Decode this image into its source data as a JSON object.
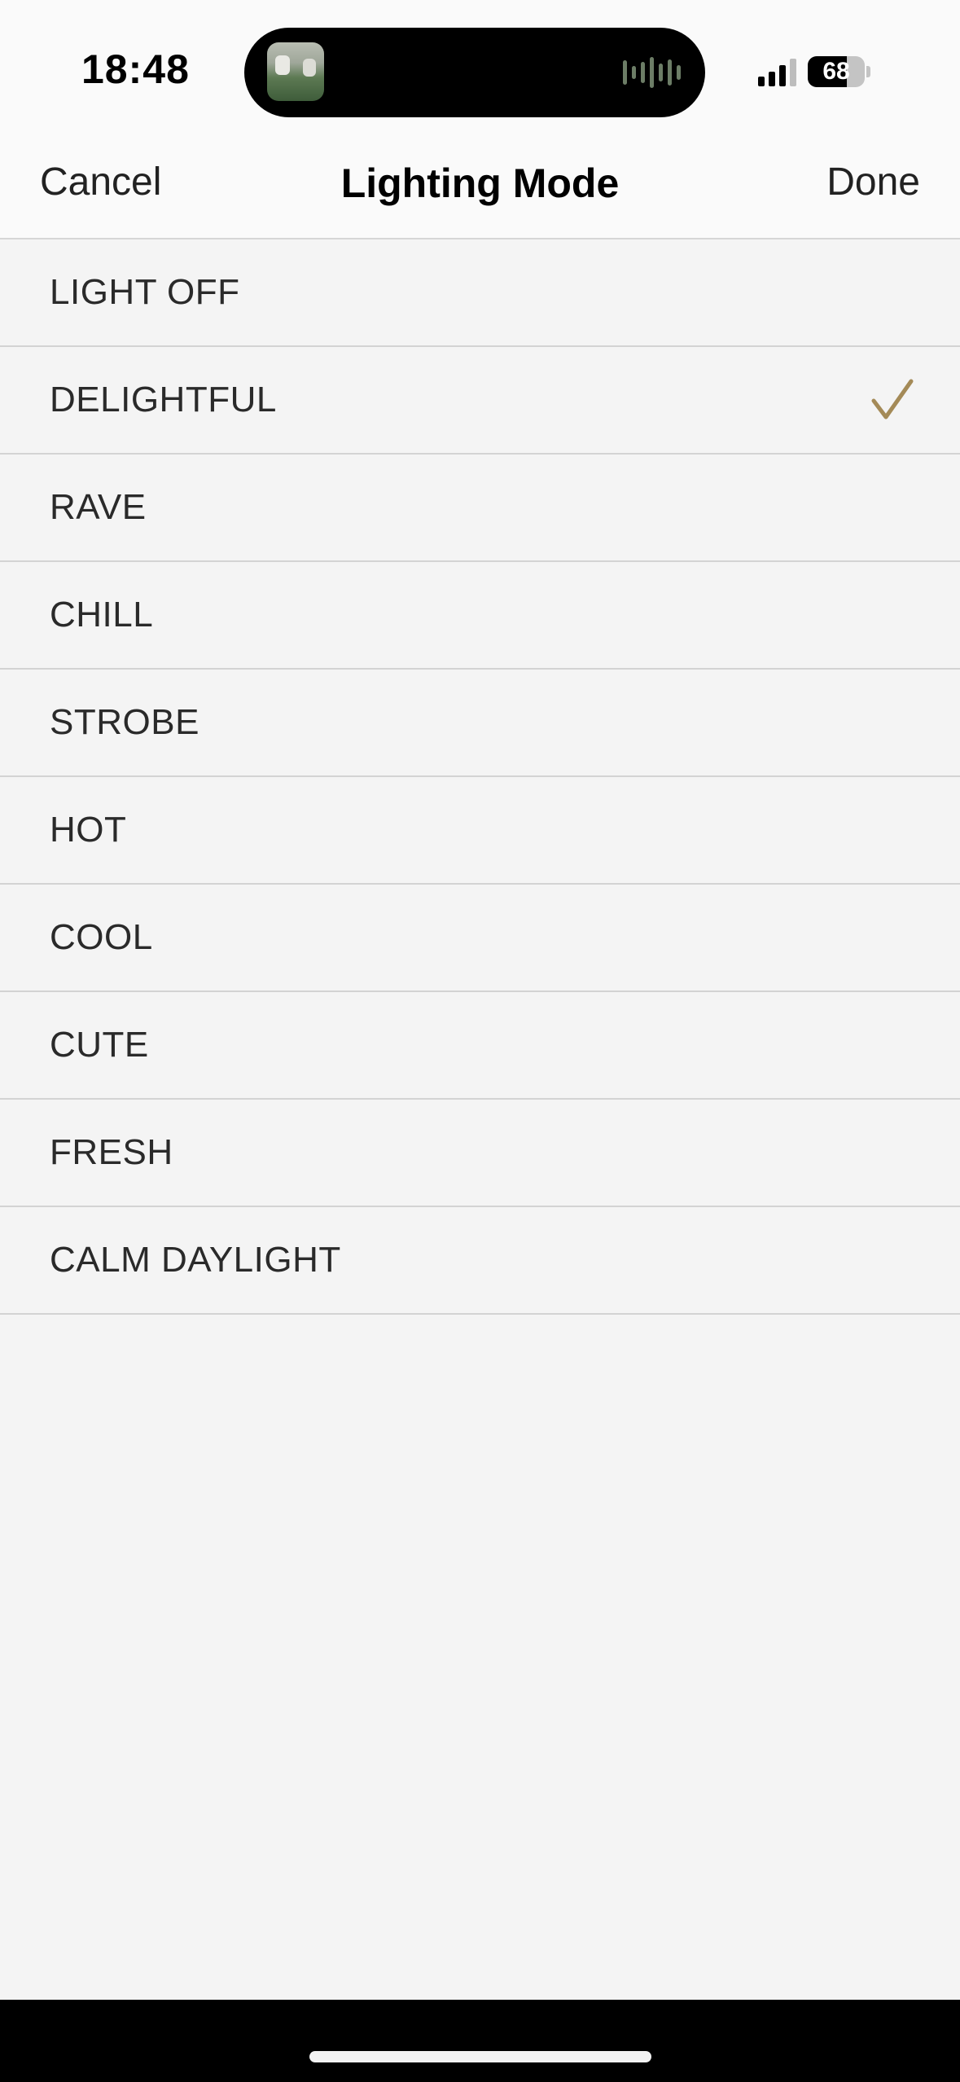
{
  "status_bar": {
    "time": "18:48",
    "battery": "68",
    "battery_level": 0.68
  },
  "nav": {
    "cancel_label": "Cancel",
    "title": "Lighting Mode",
    "done_label": "Done"
  },
  "modes": [
    {
      "label": "LIGHT OFF",
      "selected": false
    },
    {
      "label": "DELIGHTFUL",
      "selected": true
    },
    {
      "label": "RAVE",
      "selected": false
    },
    {
      "label": "CHILL",
      "selected": false
    },
    {
      "label": "STROBE",
      "selected": false
    },
    {
      "label": "HOT",
      "selected": false
    },
    {
      "label": "COOL",
      "selected": false
    },
    {
      "label": "CUTE",
      "selected": false
    },
    {
      "label": "FRESH",
      "selected": false
    },
    {
      "label": "CALM DAYLIGHT",
      "selected": false
    }
  ],
  "colors": {
    "checkmark": "#a48a57"
  }
}
